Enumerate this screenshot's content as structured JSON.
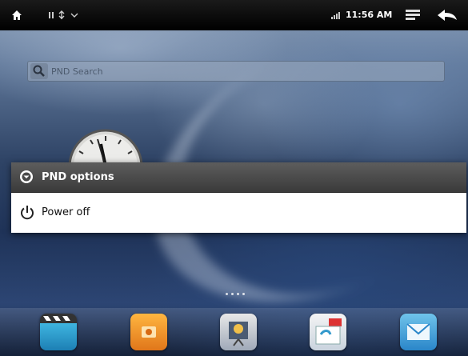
{
  "status_bar": {
    "time": "11:56 AM",
    "icons": [
      "home-icon",
      "signal-icon",
      "usb-icon",
      "wifi-icon",
      "menu-icon",
      "back-icon"
    ]
  },
  "search": {
    "placeholder": "PND Search"
  },
  "dialog": {
    "title": "PND options",
    "items": [
      {
        "label": "Power off",
        "icon": "power-icon"
      }
    ]
  },
  "dock": {
    "apps": [
      "video-app-icon",
      "photos-app-icon",
      "gallery-app-icon",
      "calendar-app-icon",
      "email-app-icon"
    ]
  },
  "colors": {
    "status_bar_bg": "#000000",
    "dialog_header_bg": "#4a4a4a",
    "dialog_item_bg": "#ffffff"
  }
}
